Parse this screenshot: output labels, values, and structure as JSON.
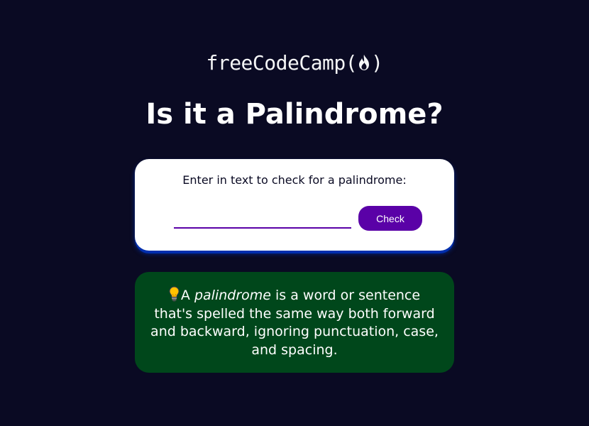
{
  "header": {
    "logo_text": "freeCodeCamp(",
    "logo_close": ")",
    "logo_icon": "flame-icon"
  },
  "page": {
    "title": "Is it a Palindrome?"
  },
  "checker": {
    "label": "Enter in text to check for a palindrome:",
    "input_value": "",
    "button_label": "Check"
  },
  "info": {
    "icon": "lightbulb-icon",
    "text_prefix": "A ",
    "term": "palindrome",
    "text_suffix": " is a word or sentence that's spelled the same way both forward and backward, ignoring punctuation, case, and spacing."
  },
  "colors": {
    "background": "#0a0a23",
    "card": "#ffffff",
    "accent": "#5a01a7",
    "info_background": "#00471b",
    "card_shadow": "#002ead"
  }
}
